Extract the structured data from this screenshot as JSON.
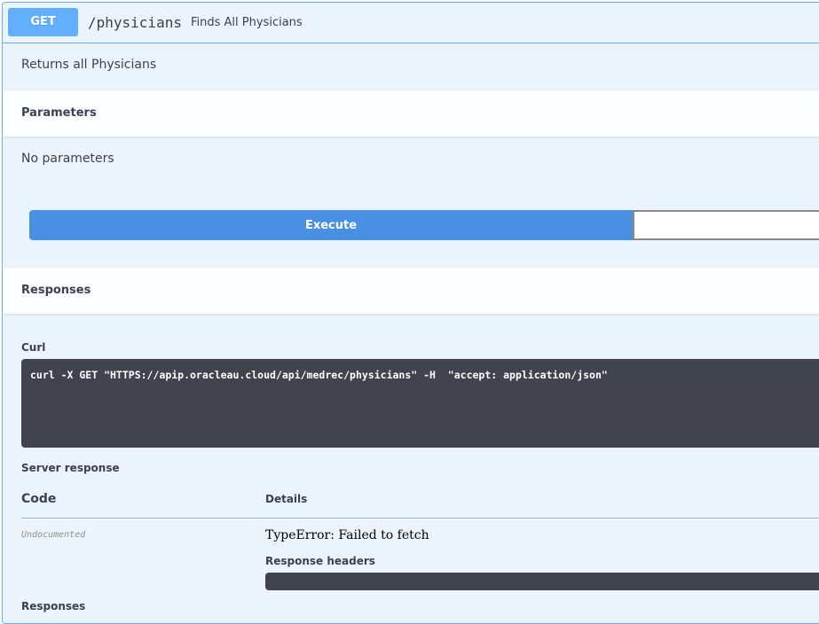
{
  "operation": {
    "method": "GET",
    "path": "/physicians",
    "summary": "Finds All Physicians",
    "description": "Returns all Physicians"
  },
  "parameters": {
    "title": "Parameters",
    "empty_text": "No parameters"
  },
  "actions": {
    "execute_label": "Execute"
  },
  "responses": {
    "title": "Responses",
    "curl_label": "Curl",
    "curl_command": "curl -X GET \"HTTPS://apip.oracleau.cloud/api/medrec/physicians\" -H  \"accept: application/json\"",
    "server_response_label": "Server response",
    "table": {
      "code_header": "Code",
      "details_header": "Details",
      "code_value": "Undocumented",
      "error_text": "TypeError: Failed to fetch",
      "response_headers_label": "Response headers"
    },
    "bottom_label": "Responses"
  },
  "colors": {
    "get_method": "#61affe",
    "execute": "#4990e2",
    "code_block": "#41444e",
    "background": "#ebf3fb"
  }
}
